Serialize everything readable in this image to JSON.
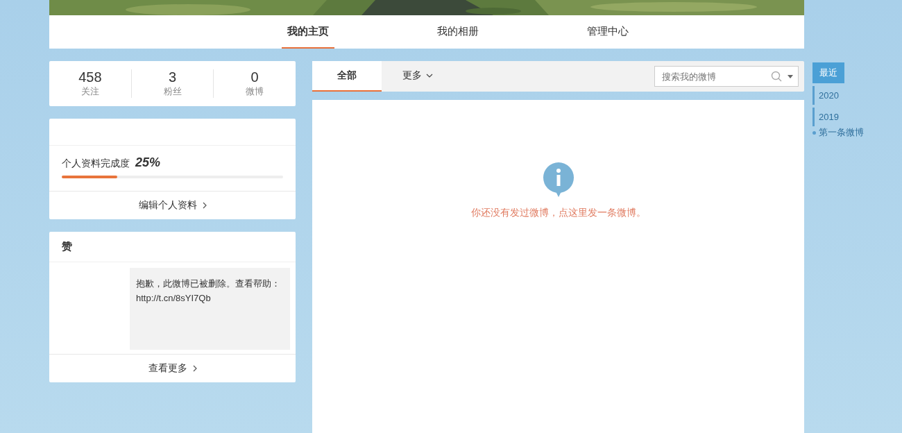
{
  "nav": [
    {
      "label": "我的主页",
      "selected": true
    },
    {
      "label": "我的相册",
      "selected": false
    },
    {
      "label": "管理中心",
      "selected": false
    }
  ],
  "stats": [
    {
      "value": "458",
      "label": "关注"
    },
    {
      "value": "3",
      "label": "粉丝"
    },
    {
      "value": "0",
      "label": "微博"
    }
  ],
  "profile": {
    "label": "个人资料完成度",
    "percent": "25%",
    "level": 0.25,
    "edit_link": "编辑个人资料"
  },
  "likes": {
    "title": "赞",
    "message": "抱歉，此微博已被删除。查看帮助：http://t.cn/8sYI7Qb",
    "more_link": "查看更多"
  },
  "feed_tabs": [
    {
      "label": "全部",
      "selected": true
    },
    {
      "label": "更多",
      "selected": false
    }
  ],
  "search": {
    "placeholder": "搜索我的微博"
  },
  "empty_message": "你还没有发过微博，点这里发一条微博。",
  "timeline": [
    {
      "label": "最近",
      "selected": true,
      "kind": "button"
    },
    {
      "label": "2020",
      "selected": false,
      "kind": "year"
    },
    {
      "label": "2019",
      "selected": false,
      "kind": "year"
    },
    {
      "label": "第一条微博",
      "selected": false,
      "kind": "first"
    }
  ]
}
